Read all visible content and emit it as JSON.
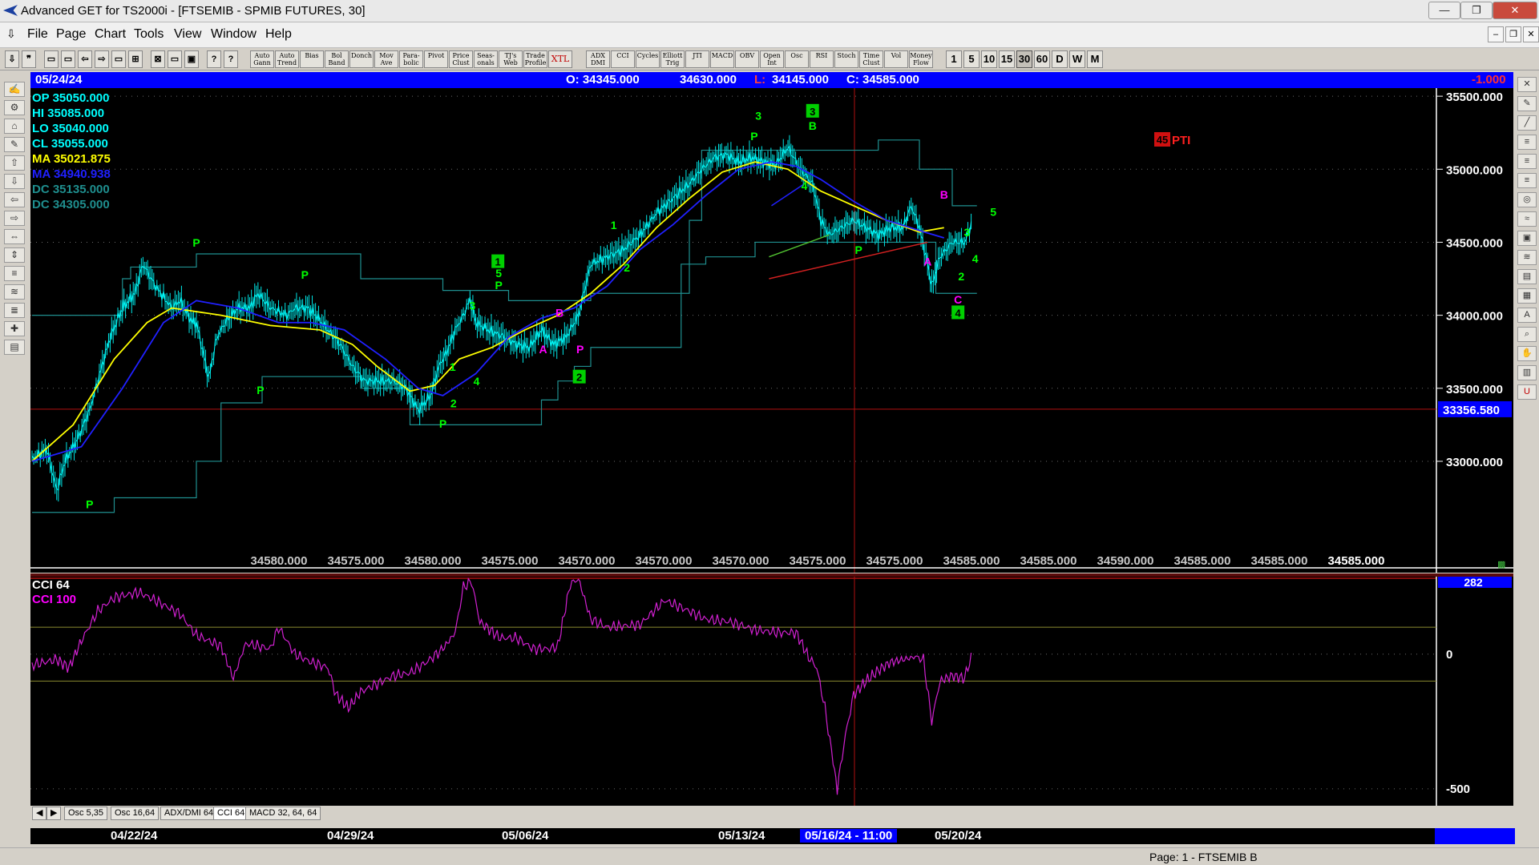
{
  "window": {
    "title": "Advanced GET for TS2000i - [FTSEMIB - SPMIB FUTURES, 30]",
    "min": "—",
    "max": "❐",
    "close": "✕"
  },
  "menu": [
    "File",
    "Page",
    "Chart",
    "Tools",
    "View",
    "Window",
    "Help"
  ],
  "toolbar": {
    "studies": [
      "Auto Gann",
      "Auto Trend",
      "Bias",
      "Bol Band",
      "Donch",
      "Mov Ave",
      "Para-bolic",
      "Pivot",
      "Price Clust",
      "Seas-onals",
      "TJ's Web",
      "Trade Profile",
      "XTL",
      "ADX DMI",
      "CCI",
      "Cycles",
      "Elliott Trig",
      "JTI",
      "MACD",
      "OBV",
      "Open Int",
      "Osc",
      "RSI",
      "Stoch",
      "Time Clust",
      "Vol",
      "Money Flow"
    ],
    "intervals": [
      "1",
      "5",
      "10",
      "15",
      "30",
      "60",
      "D",
      "W",
      "M"
    ],
    "selected_interval": "30"
  },
  "infobar": {
    "date": "05/24/24",
    "open": "O: 34345.000",
    "high": "34630.000",
    "low_label": "L:",
    "low_value": "34145.000",
    "close": "C: 34585.000",
    "change": "-1.000"
  },
  "legend": [
    {
      "label": "OP  35050.000",
      "color": "#00ffff"
    },
    {
      "label": "HI   35085.000",
      "color": "#00ffff"
    },
    {
      "label": "LO   35040.000",
      "color": "#00ffff"
    },
    {
      "label": "CL   35055.000",
      "color": "#00ffff"
    },
    {
      "label": "MA  35021.875",
      "color": "#ffff00"
    },
    {
      "label": "MA  34940.938",
      "color": "#2020ff"
    },
    {
      "label": "DC  35135.000",
      "color": "#1f8f8f"
    },
    {
      "label": "DC  34305.000",
      "color": "#1f8f8f"
    }
  ],
  "price_axis": {
    "ticks": [
      "35500.000",
      "35000.000",
      "34500.000",
      "34000.000",
      "33500.000",
      "33000.000"
    ],
    "cursor_price": "33356.580"
  },
  "pti": {
    "value": "45",
    "label": "PTI"
  },
  "bottom_values": [
    "34580.000",
    "34575.000",
    "34580.000",
    "34575.000",
    "34570.000",
    "34570.000",
    "34570.000",
    "34575.000",
    "34575.000",
    "34585.000",
    "34585.000",
    "34590.000",
    "34585.000",
    "34585.000",
    "34585.000"
  ],
  "cci": {
    "legend1": "CCI 64",
    "legend2": "CCI  100",
    "axis_top": "282",
    "axis_zero": "0",
    "axis_bottom": "-500"
  },
  "tabs": [
    "Osc 5,35",
    "Osc 16,64",
    "ADX/DMI 64",
    "CCI 64",
    "MACD 32, 64, 64"
  ],
  "active_tab": "CCI 64",
  "dates": [
    "04/22/24",
    "04/29/24",
    "05/06/24",
    "05/13/24",
    "05/16/24 - 11:00",
    "05/20/24"
  ],
  "status": "Page: 1 - FTSEMIB B",
  "chart_data": {
    "type": "line",
    "title": "FTSEMIB - SPMIB FUTURES, 30",
    "ylim": [
      32550,
      35550
    ],
    "series": [
      {
        "name": "MA",
        "color": "#ffff00",
        "points": [
          [
            0,
            33000
          ],
          [
            50,
            33250
          ],
          [
            100,
            33700
          ],
          [
            140,
            33950
          ],
          [
            170,
            34050
          ],
          [
            230,
            34000
          ],
          [
            290,
            33930
          ],
          [
            350,
            33900
          ],
          [
            390,
            33800
          ],
          [
            420,
            33650
          ],
          [
            460,
            33480
          ],
          [
            490,
            33520
          ],
          [
            520,
            33700
          ],
          [
            560,
            33780
          ],
          [
            600,
            33900
          ],
          [
            640,
            34000
          ],
          [
            680,
            34150
          ],
          [
            720,
            34350
          ],
          [
            760,
            34600
          ],
          [
            800,
            34800
          ],
          [
            840,
            34980
          ],
          [
            880,
            35050
          ],
          [
            920,
            35000
          ],
          [
            960,
            34850
          ],
          [
            1000,
            34750
          ],
          [
            1040,
            34650
          ],
          [
            1080,
            34570
          ],
          [
            1110,
            34600
          ]
        ]
      },
      {
        "name": "MA",
        "color": "#2020ff",
        "points": [
          [
            0,
            33000
          ],
          [
            60,
            33100
          ],
          [
            110,
            33500
          ],
          [
            160,
            33950
          ],
          [
            200,
            34100
          ],
          [
            250,
            34050
          ],
          [
            300,
            33950
          ],
          [
            340,
            33950
          ],
          [
            380,
            33900
          ],
          [
            430,
            33700
          ],
          [
            470,
            33500
          ],
          [
            500,
            33450
          ],
          [
            540,
            33600
          ],
          [
            580,
            33850
          ],
          [
            620,
            33980
          ],
          [
            660,
            34050
          ],
          [
            700,
            34200
          ],
          [
            740,
            34450
          ],
          [
            780,
            34620
          ],
          [
            820,
            34820
          ],
          [
            860,
            35000
          ],
          [
            900,
            35050
          ],
          [
            930,
            35020
          ],
          [
            960,
            34930
          ],
          [
            1000,
            34780
          ],
          [
            1040,
            34650
          ],
          [
            1080,
            34580
          ],
          [
            1110,
            34530
          ]
        ]
      }
    ],
    "price": [
      [
        0,
        33020
      ],
      [
        18,
        33080
      ],
      [
        30,
        32800
      ],
      [
        40,
        33000
      ],
      [
        55,
        33150
      ],
      [
        70,
        33350
      ],
      [
        80,
        33550
      ],
      [
        95,
        33850
      ],
      [
        110,
        34050
      ],
      [
        125,
        34150
      ],
      [
        135,
        34350
      ],
      [
        150,
        34200
      ],
      [
        170,
        34050
      ],
      [
        180,
        34100
      ],
      [
        195,
        33950
      ],
      [
        200,
        33950
      ],
      [
        215,
        33570
      ],
      [
        225,
        33850
      ],
      [
        235,
        33950
      ],
      [
        250,
        34050
      ],
      [
        265,
        34050
      ],
      [
        275,
        34150
      ],
      [
        290,
        34050
      ],
      [
        310,
        34000
      ],
      [
        320,
        34050
      ],
      [
        335,
        34050
      ],
      [
        345,
        34000
      ],
      [
        360,
        33900
      ],
      [
        375,
        33800
      ],
      [
        390,
        33650
      ],
      [
        405,
        33550
      ],
      [
        420,
        33550
      ],
      [
        440,
        33550
      ],
      [
        455,
        33500
      ],
      [
        470,
        33350
      ],
      [
        485,
        33450
      ],
      [
        495,
        33650
      ],
      [
        505,
        33750
      ],
      [
        515,
        33900
      ],
      [
        525,
        34000
      ],
      [
        533,
        34110
      ],
      [
        540,
        33950
      ],
      [
        555,
        33900
      ],
      [
        575,
        33850
      ],
      [
        590,
        33800
      ],
      [
        605,
        33780
      ],
      [
        620,
        33900
      ],
      [
        635,
        33800
      ],
      [
        650,
        33850
      ],
      [
        665,
        34000
      ],
      [
        680,
        34350
      ],
      [
        700,
        34400
      ],
      [
        720,
        34450
      ],
      [
        740,
        34550
      ],
      [
        760,
        34700
      ],
      [
        780,
        34800
      ],
      [
        800,
        34900
      ],
      [
        815,
        35000
      ],
      [
        830,
        35080
      ],
      [
        845,
        35100
      ],
      [
        860,
        35050
      ],
      [
        875,
        35080
      ],
      [
        890,
        35050
      ],
      [
        905,
        35030
      ],
      [
        920,
        35150
      ],
      [
        935,
        35000
      ],
      [
        950,
        34900
      ],
      [
        960,
        34650
      ],
      [
        970,
        34550
      ],
      [
        985,
        34600
      ],
      [
        1000,
        34650
      ],
      [
        1015,
        34600
      ],
      [
        1030,
        34550
      ],
      [
        1045,
        34600
      ],
      [
        1060,
        34600
      ],
      [
        1070,
        34750
      ],
      [
        1080,
        34600
      ],
      [
        1090,
        34350
      ],
      [
        1095,
        34200
      ],
      [
        1105,
        34400
      ],
      [
        1120,
        34500
      ],
      [
        1135,
        34500
      ],
      [
        1145,
        34650
      ]
    ],
    "cci": [
      [
        0,
        -40
      ],
      [
        30,
        -20
      ],
      [
        45,
        -50
      ],
      [
        60,
        50
      ],
      [
        80,
        160
      ],
      [
        100,
        210
      ],
      [
        130,
        230
      ],
      [
        150,
        200
      ],
      [
        180,
        150
      ],
      [
        200,
        70
      ],
      [
        230,
        30
      ],
      [
        245,
        -90
      ],
      [
        260,
        40
      ],
      [
        290,
        20
      ],
      [
        300,
        100
      ],
      [
        320,
        0
      ],
      [
        340,
        -30
      ],
      [
        360,
        -50
      ],
      [
        370,
        -150
      ],
      [
        385,
        -200
      ],
      [
        400,
        -140
      ],
      [
        420,
        -110
      ],
      [
        440,
        -80
      ],
      [
        460,
        -70
      ],
      [
        480,
        -30
      ],
      [
        500,
        20
      ],
      [
        515,
        80
      ],
      [
        525,
        250
      ],
      [
        535,
        270
      ],
      [
        545,
        120
      ],
      [
        570,
        60
      ],
      [
        590,
        60
      ],
      [
        610,
        20
      ],
      [
        630,
        20
      ],
      [
        640,
        30
      ],
      [
        655,
        260
      ],
      [
        665,
        280
      ],
      [
        680,
        130
      ],
      [
        700,
        100
      ],
      [
        740,
        110
      ],
      [
        770,
        200
      ],
      [
        800,
        160
      ],
      [
        820,
        130
      ],
      [
        850,
        120
      ],
      [
        880,
        90
      ],
      [
        910,
        80
      ],
      [
        930,
        80
      ],
      [
        945,
        -10
      ],
      [
        955,
        -50
      ],
      [
        965,
        -200
      ],
      [
        975,
        -400
      ],
      [
        980,
        -500
      ],
      [
        990,
        -300
      ],
      [
        1000,
        -150
      ],
      [
        1015,
        -100
      ],
      [
        1030,
        -60
      ],
      [
        1045,
        -30
      ],
      [
        1060,
        -20
      ],
      [
        1075,
        -10
      ],
      [
        1085,
        -20
      ],
      [
        1095,
        -250
      ],
      [
        1105,
        -100
      ],
      [
        1120,
        -80
      ],
      [
        1135,
        -90
      ],
      [
        1145,
        10
      ]
    ]
  },
  "wave_labels": [
    {
      "t": "P",
      "x": 70,
      "y": 32680,
      "c": "#00ff00"
    },
    {
      "t": "P",
      "x": 200,
      "y": 34470,
      "c": "#00ff00"
    },
    {
      "t": "P",
      "x": 278,
      "y": 33460,
      "c": "#00ff00"
    },
    {
      "t": "P",
      "x": 332,
      "y": 34250,
      "c": "#00ff00"
    },
    {
      "t": "P",
      "x": 500,
      "y": 33230,
      "c": "#00ff00"
    },
    {
      "t": "1",
      "x": 512,
      "y": 33620,
      "c": "#00ff00"
    },
    {
      "t": "2",
      "x": 513,
      "y": 33370,
      "c": "#00ff00"
    },
    {
      "t": "3",
      "x": 536,
      "y": 34040,
      "c": "#00ff00"
    },
    {
      "t": "4",
      "x": 541,
      "y": 33520,
      "c": "#00ff00"
    },
    {
      "t": "5",
      "x": 568,
      "y": 34260,
      "c": "#00ff00"
    },
    {
      "t": "P",
      "x": 568,
      "y": 34180,
      "c": "#00ff00"
    },
    {
      "t": "A",
      "x": 622,
      "y": 33740,
      "c": "#ff00ff"
    },
    {
      "t": "B",
      "x": 642,
      "y": 33990,
      "c": "#ff00ff"
    },
    {
      "t": "P",
      "x": 667,
      "y": 33740,
      "c": "#ff00ff"
    },
    {
      "t": "1",
      "x": 708,
      "y": 34590,
      "c": "#00ff00"
    },
    {
      "t": "2",
      "x": 724,
      "y": 34300,
      "c": "#00ff00"
    },
    {
      "t": "P",
      "x": 879,
      "y": 35200,
      "c": "#00ff00"
    },
    {
      "t": "3",
      "x": 884,
      "y": 35340,
      "c": "#00ff00"
    },
    {
      "t": "B",
      "x": 950,
      "y": 35270,
      "c": "#00ff00"
    },
    {
      "t": "4",
      "x": 940,
      "y": 34860,
      "c": "#00ff00"
    },
    {
      "t": "P",
      "x": 1006,
      "y": 34420,
      "c": "#00ff00"
    },
    {
      "t": "A",
      "x": 1090,
      "y": 34340,
      "c": "#ff00ff"
    },
    {
      "t": "B",
      "x": 1110,
      "y": 34800,
      "c": "#ff00ff"
    },
    {
      "t": "3",
      "x": 1138,
      "y": 34540,
      "c": "#00ff00"
    },
    {
      "t": "4",
      "x": 1148,
      "y": 34360,
      "c": "#00ff00"
    },
    {
      "t": "5",
      "x": 1170,
      "y": 34680,
      "c": "#00ff00"
    },
    {
      "t": "C",
      "x": 1127,
      "y": 34080,
      "c": "#ff00ff"
    },
    {
      "t": "2",
      "x": 1131,
      "y": 34240,
      "c": "#00ff00"
    }
  ],
  "boxed_labels": [
    {
      "t": "1",
      "x": 567,
      "y": 34340
    },
    {
      "t": "2",
      "x": 666,
      "y": 33550
    },
    {
      "t": "3",
      "x": 950,
      "y": 35370
    },
    {
      "t": "4",
      "x": 1127,
      "y": 33990
    }
  ]
}
